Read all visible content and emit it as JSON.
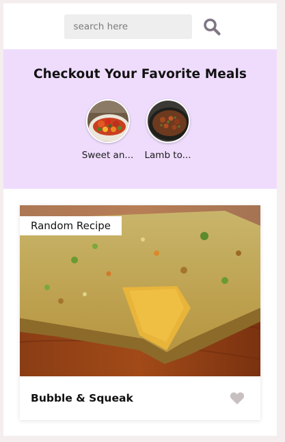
{
  "search": {
    "placeholder": "search here",
    "value": "",
    "icon": "search-icon"
  },
  "favorites": {
    "title": "Checkout Your Favorite Meals",
    "items": [
      {
        "label": "Sweet an...",
        "image": "sweet-and-sour-dish"
      },
      {
        "label": "Lamb to...",
        "image": "lamb-tomato-dish"
      }
    ],
    "background": "#efdcfd"
  },
  "random": {
    "tag": "Random Recipe",
    "name": "Bubble & Squeak",
    "image": "bubble-and-squeak-photo",
    "like_icon": "heart-icon",
    "like_color": "#c8c0c0"
  }
}
